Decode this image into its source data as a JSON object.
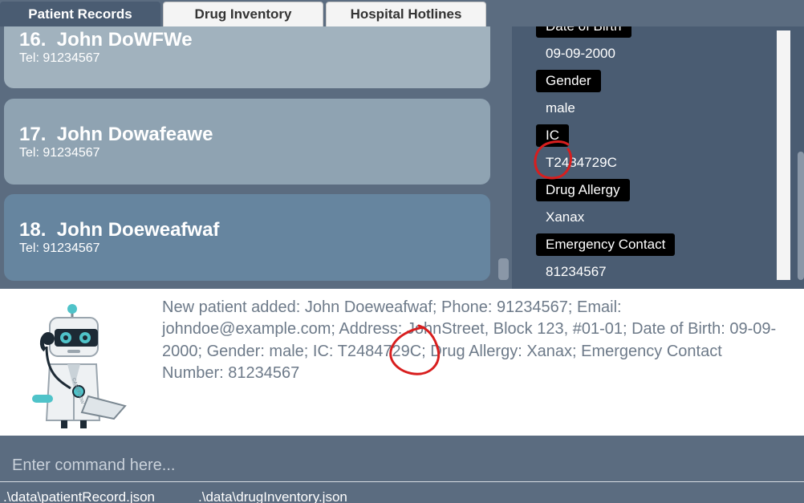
{
  "tabs": [
    {
      "label": "Patient Records",
      "active": true
    },
    {
      "label": "Drug Inventory",
      "active": false
    },
    {
      "label": "Hospital Hotlines",
      "active": false
    }
  ],
  "patients": [
    {
      "index": "16.",
      "name": "John DoWFWe",
      "tel": "Tel: 91234567",
      "color": "#a1b2be"
    },
    {
      "index": "17.",
      "name": "John Dowafeawe",
      "tel": "Tel: 91234567",
      "color": "#8fa3b2"
    },
    {
      "index": "18.",
      "name": "John Doeweafwaf",
      "tel": "Tel: 91234567",
      "color": "#66859f"
    }
  ],
  "details": {
    "fields": [
      {
        "label": "Date of Birth",
        "value": "09-09-2000"
      },
      {
        "label": "Gender",
        "value": "male"
      },
      {
        "label": "IC",
        "value": "T2484729C"
      },
      {
        "label": "Drug Allergy",
        "value": "Xanax"
      },
      {
        "label": "Emergency Contact",
        "value": "81234567"
      }
    ]
  },
  "result": {
    "message": "New patient added: John Doeweafwaf; Phone: 91234567; Email: johndoe@example.com; Address: JohnStreet, Block 123, #01-01; Date of Birth: 09-09-2000; Gender: male; IC: T2484729C; Drug Allergy: Xanax; Emergency Contact Number: 81234567",
    "mascot_text": "CAREFLOW"
  },
  "command": {
    "placeholder": "Enter command here...",
    "value": ""
  },
  "status": {
    "patient_file": ".\\data\\patientRecord.json",
    "drug_file": ".\\data\\drugInventory.json"
  },
  "colors": {
    "background": "#5b6c80",
    "detail_background": "#4a5c72",
    "label_background": "#000000",
    "result_text": "#6d7a89",
    "annotation": "#d81e1e"
  }
}
